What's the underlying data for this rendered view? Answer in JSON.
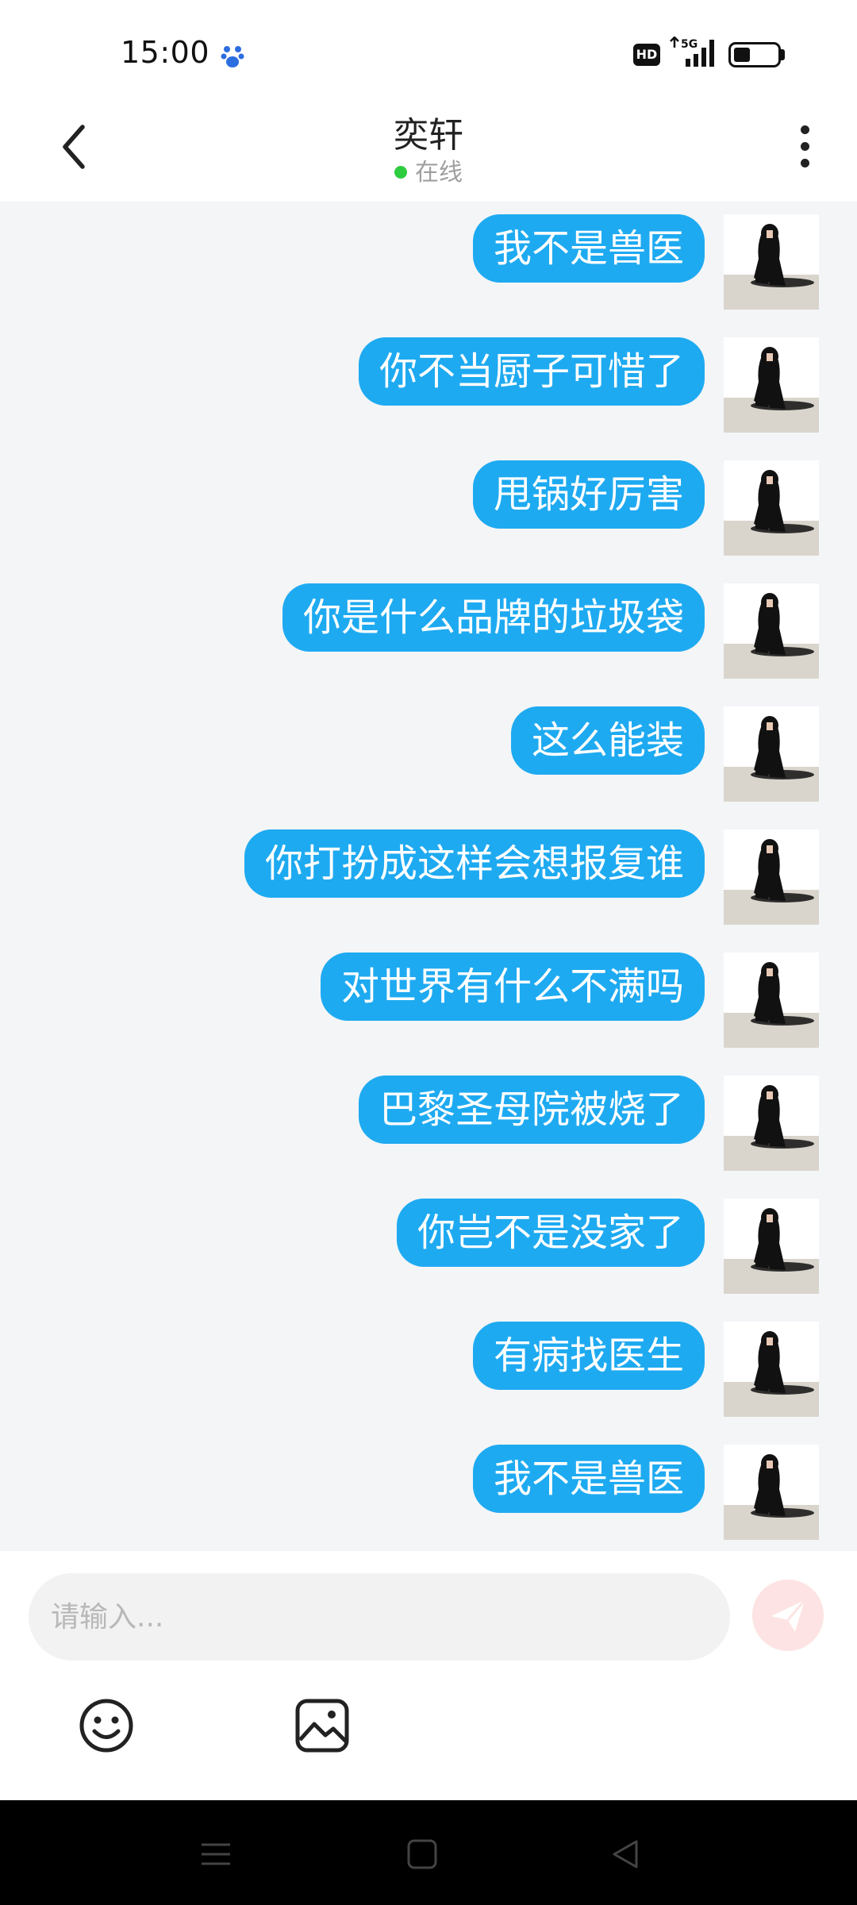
{
  "status_bar": {
    "time": "15:00",
    "hd_label": "HD",
    "network_label": "5G"
  },
  "header": {
    "contact_name": "奕轩",
    "status_text": "在线",
    "online_color": "#2ecc40"
  },
  "messages": [
    {
      "text": "我不是兽医",
      "side": "right"
    },
    {
      "text": "你不当厨子可惜了",
      "side": "right"
    },
    {
      "text": "甩锅好厉害",
      "side": "right"
    },
    {
      "text": "你是什么品牌的垃圾袋",
      "side": "right"
    },
    {
      "text": "这么能装",
      "side": "right"
    },
    {
      "text": "你打扮成这样会想报复谁",
      "side": "right"
    },
    {
      "text": "对世界有什么不满吗",
      "side": "right"
    },
    {
      "text": "巴黎圣母院被烧了",
      "side": "right"
    },
    {
      "text": "你岂不是没家了",
      "side": "right"
    },
    {
      "text": "有病找医生",
      "side": "right"
    },
    {
      "text": "我不是兽医",
      "side": "right"
    }
  ],
  "composer": {
    "placeholder": "请输入...",
    "value": ""
  },
  "colors": {
    "bubble": "#1eaaf1",
    "chat_background": "#f4f5f7",
    "send_button": "#fde3e3"
  },
  "icons": [
    "paw-icon",
    "signal-icon",
    "battery-icon",
    "back-arrow-icon",
    "more-icon",
    "avatar-image",
    "send-icon",
    "emoji-icon",
    "image-icon",
    "menu-icon",
    "home-icon",
    "triangle-back-icon"
  ]
}
